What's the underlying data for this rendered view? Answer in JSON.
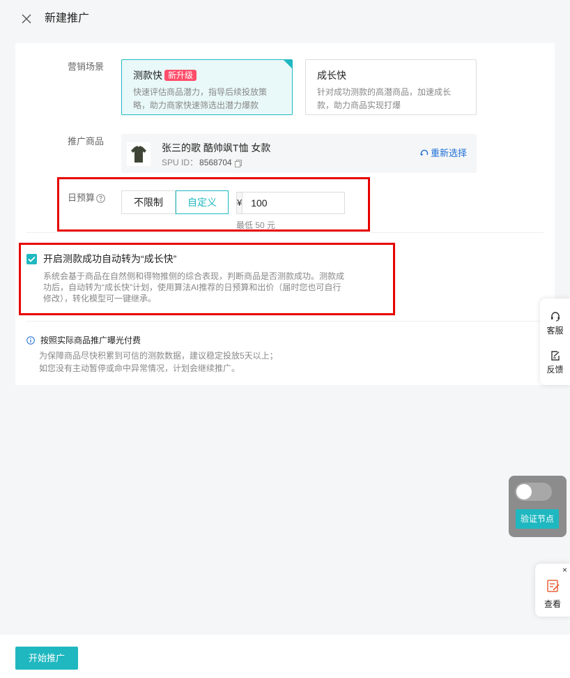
{
  "header": {
    "title": "新建推广"
  },
  "scene": {
    "label": "营销场景",
    "options": [
      {
        "title": "测款快",
        "badge": "新升级",
        "desc_line1": "快速评估商品潜力，指导后续投放策",
        "desc_line2": "略，助力商家快速筛选出潜力爆款",
        "selected": true
      },
      {
        "title": "成长快",
        "desc_line1": "针对成功测款的高潜商品，加速成长",
        "desc_line2": "款，助力商品实现打爆",
        "selected": false
      }
    ]
  },
  "product": {
    "label": "推广商品",
    "name": "张三的歌 酷帅飒T恤 女款",
    "spu_label": "SPU ID：",
    "spu_id": "8568704",
    "reselect": "重新选择"
  },
  "budget": {
    "label": "日预算",
    "unlimited": "不限制",
    "custom": "自定义",
    "currency": "¥",
    "value": "100",
    "min_hint": "最低 50 元"
  },
  "auto_convert": {
    "checked": true,
    "label": "开启测款成功自动转为“成长快”",
    "desc_line1": "系统会基于商品在自然侧和得物推侧的综合表现，判断商品是否测款成功。测款成",
    "desc_line2": "功后，自动转为“成长快”计划，使用算法AI推荐的日预算和出价（届时您也可自行",
    "desc_line3": "修改），转化模型可一键继承。"
  },
  "tip": {
    "title": "按照实际商品推广曝光付费",
    "line1": "为保障商品尽快积累到可信的测款数据，建议稳定投放5天以上；",
    "line2": "如您没有主动暂停或命中异常情况，计划会继续推广。"
  },
  "side": {
    "service": "客服",
    "feedback": "反馈"
  },
  "verify": {
    "button": "验证节点",
    "toggle_on": false
  },
  "view": {
    "close": "×",
    "label": "查看"
  },
  "footer": {
    "start": "开始推广"
  },
  "colors": {
    "accent": "#20b8c0",
    "badge": "#ff4d6a",
    "highlight_box": "#e60000",
    "link": "#1d6fd6"
  }
}
